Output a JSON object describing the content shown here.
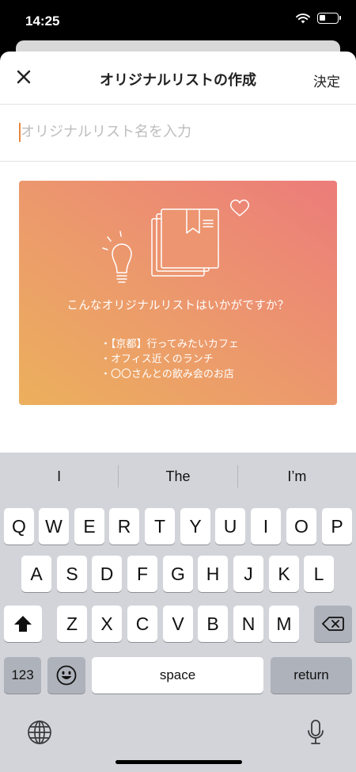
{
  "status_bar": {
    "time": "14:25"
  },
  "header": {
    "title": "オリジナルリストの作成",
    "confirm_label": "決定"
  },
  "name_input": {
    "placeholder": "オリジナルリスト名を入力",
    "value": ""
  },
  "promo": {
    "question": "こんなオリジナルリストはいかがですか？",
    "examples": [
      "・【京都】行ってみたいカフェ",
      "・オフィス近くのランチ",
      "・〇〇さんとの飲み会のお店"
    ]
  },
  "keyboard": {
    "suggestions": [
      "I",
      "The",
      "I’m"
    ],
    "row1": [
      "Q",
      "W",
      "E",
      "R",
      "T",
      "Y",
      "U",
      "I",
      "O",
      "P"
    ],
    "row2": [
      "A",
      "S",
      "D",
      "F",
      "G",
      "H",
      "J",
      "K",
      "L"
    ],
    "row3": [
      "Z",
      "X",
      "C",
      "V",
      "B",
      "N",
      "M"
    ],
    "numbers_label": "123",
    "space_label": "space",
    "return_label": "return"
  },
  "colors": {
    "accent": "#e8883f",
    "promo_gradient_start": "#ecb05c",
    "promo_gradient_end": "#ec7c7a",
    "keyboard_bg": "#d2d4da"
  }
}
